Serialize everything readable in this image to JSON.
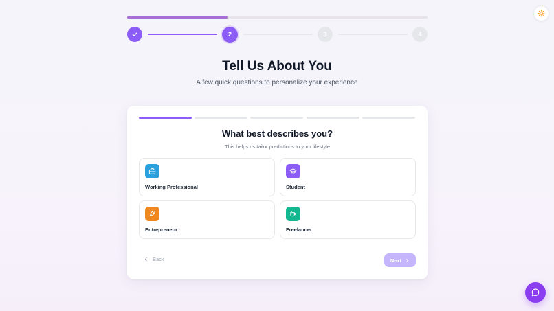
{
  "stepper": {
    "steps": [
      {
        "label": "✓",
        "state": "done"
      },
      {
        "label": "2",
        "state": "active"
      },
      {
        "label": "3",
        "state": "pending"
      },
      {
        "label": "4",
        "state": "pending"
      }
    ],
    "overall_progress_fraction": 0.33
  },
  "header": {
    "title": "Tell Us About You",
    "subtitle": "A few quick questions to personalize your experience"
  },
  "question": {
    "progress": {
      "current": 1,
      "total": 5
    },
    "title": "What best describes you?",
    "subtitle": "This helps us tailor predictions to your lifestyle",
    "options": [
      {
        "label": "Working Professional",
        "icon": "briefcase-icon",
        "color": "#2aa1de"
      },
      {
        "label": "Student",
        "icon": "graduation-cap-icon",
        "color": "#8b5cf6"
      },
      {
        "label": "Entrepreneur",
        "icon": "rocket-icon",
        "color": "#f0871f"
      },
      {
        "label": "Freelancer",
        "icon": "coffee-icon",
        "color": "#14b890"
      }
    ]
  },
  "nav": {
    "back_label": "Back",
    "next_label": "Next"
  },
  "colors": {
    "accent": "#8b5cf6",
    "next_disabled": "#c4b5fd",
    "chat": "#8b3df0"
  }
}
